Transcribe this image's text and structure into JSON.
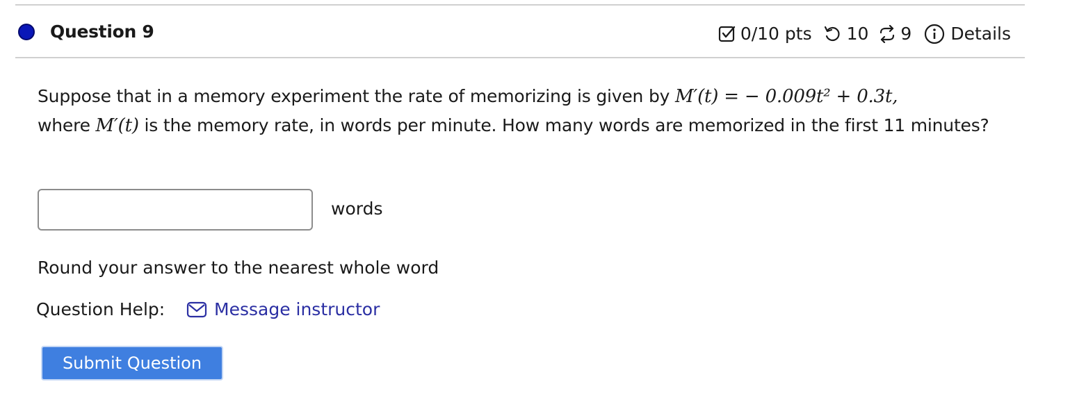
{
  "question": {
    "title": "Question 9",
    "status_color": "#0a17b8",
    "points": "0/10 pts",
    "retries": "10",
    "versions": "9",
    "details_label": "Details",
    "icons": {
      "points": "checkbox-icon",
      "retries": "retry-icon",
      "versions": "version-swap-icon",
      "details": "info-icon"
    }
  },
  "body": {
    "text_1": "Suppose that in a memory experiment the rate of memorizing is given by ",
    "math_1": "M′(t) = − 0.009t² + 0.3t,",
    "text_2": "where ",
    "math_2": "M′(t)",
    "text_3": " is the memory rate, in words per minute. How many words are memorized in the first 11 minutes?"
  },
  "answer": {
    "value": "",
    "placeholder": "",
    "unit": "words"
  },
  "note": "Round your answer to the nearest whole word",
  "help": {
    "label": "Question Help:",
    "message_link": "Message instructor",
    "link_color": "#2b2fa3"
  },
  "submit": {
    "label": "Submit Question",
    "color": "#3f7fe0"
  }
}
